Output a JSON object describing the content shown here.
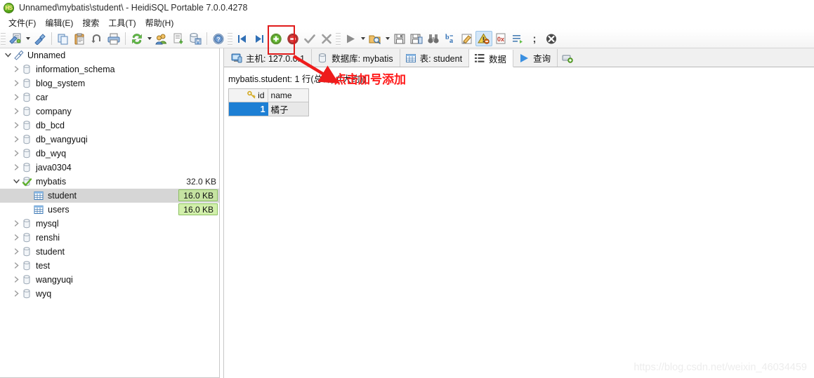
{
  "window": {
    "title": "Unnamed\\mybatis\\student\\ - HeidiSQL Portable 7.0.0.4278",
    "app_icon": "heidisql-logo-icon"
  },
  "menubar": {
    "items": [
      {
        "label": "文件(F)",
        "name": "menu-file"
      },
      {
        "label": "编辑(E)",
        "name": "menu-edit"
      },
      {
        "label": "搜索",
        "name": "menu-search"
      },
      {
        "label": "工具(T)",
        "name": "menu-tools"
      },
      {
        "label": "帮助(H)",
        "name": "menu-help"
      }
    ]
  },
  "toolbar": {
    "buttons": [
      {
        "name": "session-manager-icon",
        "tip": "会话管理器"
      },
      {
        "name": "session-dropdown-arrow",
        "tip": ""
      },
      {
        "name": "disconnect-icon",
        "tip": "断开连接"
      },
      {
        "name": "copy-icon",
        "tip": "复制"
      },
      {
        "name": "paste-icon",
        "tip": "粘贴"
      },
      {
        "name": "undo-icon",
        "tip": "撤销"
      },
      {
        "name": "print-icon",
        "tip": "打印"
      },
      {
        "name": "refresh-icon",
        "tip": "刷新"
      },
      {
        "name": "refresh-dropdown-arrow",
        "tip": ""
      },
      {
        "name": "user-manager-icon",
        "tip": "用户管理"
      },
      {
        "name": "export-grid-icon",
        "tip": "导出数据"
      },
      {
        "name": "import-icon",
        "tip": "导入"
      },
      {
        "name": "help-icon",
        "tip": "帮助"
      },
      {
        "name": "first-row-icon",
        "tip": "第一行"
      },
      {
        "name": "last-row-icon",
        "tip": "最后一行"
      },
      {
        "name": "insert-row-icon",
        "tip": "插入行"
      },
      {
        "name": "delete-row-icon",
        "tip": "删除行"
      },
      {
        "name": "post-changes-icon",
        "tip": "保存修改"
      },
      {
        "name": "cancel-changes-icon",
        "tip": "取消修改"
      },
      {
        "name": "run-query-icon",
        "tip": "执行"
      },
      {
        "name": "run-dropdown-arrow",
        "tip": ""
      },
      {
        "name": "load-sql-icon",
        "tip": "打开 SQL 文件"
      },
      {
        "name": "load-dropdown-arrow",
        "tip": ""
      },
      {
        "name": "save-icon",
        "tip": "保存"
      },
      {
        "name": "save-as-icon",
        "tip": "另存为"
      },
      {
        "name": "find-icon",
        "tip": "查找"
      },
      {
        "name": "replace-icon",
        "tip": "替换"
      },
      {
        "name": "format-sql-icon",
        "tip": "格式化 SQL"
      },
      {
        "name": "warning-icon",
        "tip": "警告"
      },
      {
        "name": "hex-icon",
        "tip": "十六进制"
      },
      {
        "name": "snippet-icon",
        "tip": "片段"
      },
      {
        "name": "delimiter-icon",
        "tip": "分隔符"
      },
      {
        "name": "stop-icon",
        "tip": "停止"
      }
    ]
  },
  "sidebar": {
    "root": {
      "label": "Unnamed",
      "icon": "connection-icon",
      "expanded": true
    },
    "items": [
      {
        "label": "information_schema",
        "icon": "database-icon",
        "size": "",
        "expanded": false,
        "level": 1
      },
      {
        "label": "blog_system",
        "icon": "database-icon",
        "size": "",
        "expanded": false,
        "level": 1
      },
      {
        "label": "car",
        "icon": "database-icon",
        "size": "",
        "expanded": false,
        "level": 1
      },
      {
        "label": "company",
        "icon": "database-icon",
        "size": "",
        "expanded": false,
        "level": 1
      },
      {
        "label": "db_bcd",
        "icon": "database-icon",
        "size": "",
        "expanded": false,
        "level": 1
      },
      {
        "label": "db_wangyuqi",
        "icon": "database-icon",
        "size": "",
        "expanded": false,
        "level": 1
      },
      {
        "label": "db_wyq",
        "icon": "database-icon",
        "size": "",
        "expanded": false,
        "level": 1
      },
      {
        "label": "java0304",
        "icon": "database-icon",
        "size": "",
        "expanded": false,
        "level": 1
      },
      {
        "label": "mybatis",
        "icon": "database-active-icon",
        "size": "32.0 KB",
        "expanded": true,
        "level": 1
      },
      {
        "label": "student",
        "icon": "table-icon",
        "size": "16.0 KB",
        "badge": true,
        "selected": true,
        "level": 2
      },
      {
        "label": "users",
        "icon": "table-icon",
        "size": "16.0 KB",
        "badge": true,
        "selected": false,
        "level": 2
      },
      {
        "label": "mysql",
        "icon": "database-icon",
        "size": "",
        "expanded": false,
        "level": 1
      },
      {
        "label": "renshi",
        "icon": "database-icon",
        "size": "",
        "expanded": false,
        "level": 1
      },
      {
        "label": "student",
        "icon": "database-icon",
        "size": "",
        "expanded": false,
        "level": 1
      },
      {
        "label": "test",
        "icon": "database-icon",
        "size": "",
        "expanded": false,
        "level": 1
      },
      {
        "label": "wangyuqi",
        "icon": "database-icon",
        "size": "",
        "expanded": false,
        "level": 1
      },
      {
        "label": "wyq",
        "icon": "database-icon",
        "size": "",
        "expanded": false,
        "level": 1
      }
    ]
  },
  "tabs": [
    {
      "label": "主机: 127.0.0.1",
      "icon": "host-icon",
      "selected": false
    },
    {
      "label": "数据库: mybatis",
      "icon": "database-icon",
      "selected": false
    },
    {
      "label": "表: student",
      "icon": "table-icon",
      "selected": false
    },
    {
      "label": "数据",
      "icon": "data-icon",
      "selected": true
    },
    {
      "label": "查询",
      "icon": "query-run-icon",
      "selected": false
    },
    {
      "label": "",
      "icon": "new-query-tab-icon",
      "selected": false
    }
  ],
  "data_tab": {
    "row_info": "mybatis.student: 1 行(总计) ((大约))",
    "grid": {
      "columns": [
        {
          "label": "id",
          "icon": "primary-key-icon"
        },
        {
          "label": "name",
          "icon": ""
        }
      ],
      "rows": [
        {
          "id": "1",
          "name": "橘子",
          "selected": true
        }
      ]
    }
  },
  "annotations": {
    "callout_text": "点击加号添加",
    "color": "#ff1a1a",
    "highlight_target": "insert-row-icon"
  },
  "watermark": {
    "text": "https://blog.csdn.net/weixin_46034459"
  }
}
